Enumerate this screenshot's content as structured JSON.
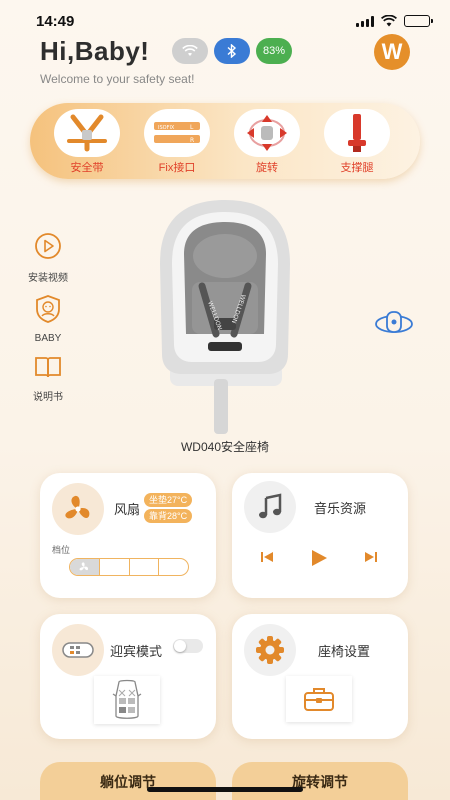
{
  "status_bar": {
    "time": "14:49"
  },
  "header": {
    "greeting": "Hi,Baby!",
    "subtitle": "Welcome to your safety seat!",
    "battery_pill": "83%",
    "logo_letter": "W",
    "colors": {
      "accent": "#e58f2a",
      "bluetooth": "#3a7bd5",
      "battery": "#4caf50"
    }
  },
  "features": [
    {
      "label": "安全带",
      "icon": "harness-icon"
    },
    {
      "label": "Fix接口",
      "icon": "isofix-icon"
    },
    {
      "label": "旋转",
      "icon": "rotate-icon"
    },
    {
      "label": "支撑腿",
      "icon": "support-leg-icon"
    }
  ],
  "side_menu": [
    {
      "label": "安装视频",
      "icon": "play-icon"
    },
    {
      "label": "BABY",
      "icon": "baby-shield-icon"
    },
    {
      "label": "说明书",
      "icon": "book-icon"
    }
  ],
  "seat": {
    "name": "WD040安全座椅",
    "brand_text": "WELLDON"
  },
  "fan_card": {
    "title": "风扇",
    "seat_temp": "坐垫27°C",
    "back_temp": "靠背28°C",
    "gear_label": "档位",
    "gear_level": 1,
    "gear_total": 4
  },
  "music_card": {
    "title": "音乐资源"
  },
  "welcome_card": {
    "title": "迎宾模式",
    "enabled": false
  },
  "settings_card": {
    "title": "座椅设置"
  },
  "bottom_buttons": {
    "recline": "躺位调节",
    "rotation": "旋转调节"
  }
}
